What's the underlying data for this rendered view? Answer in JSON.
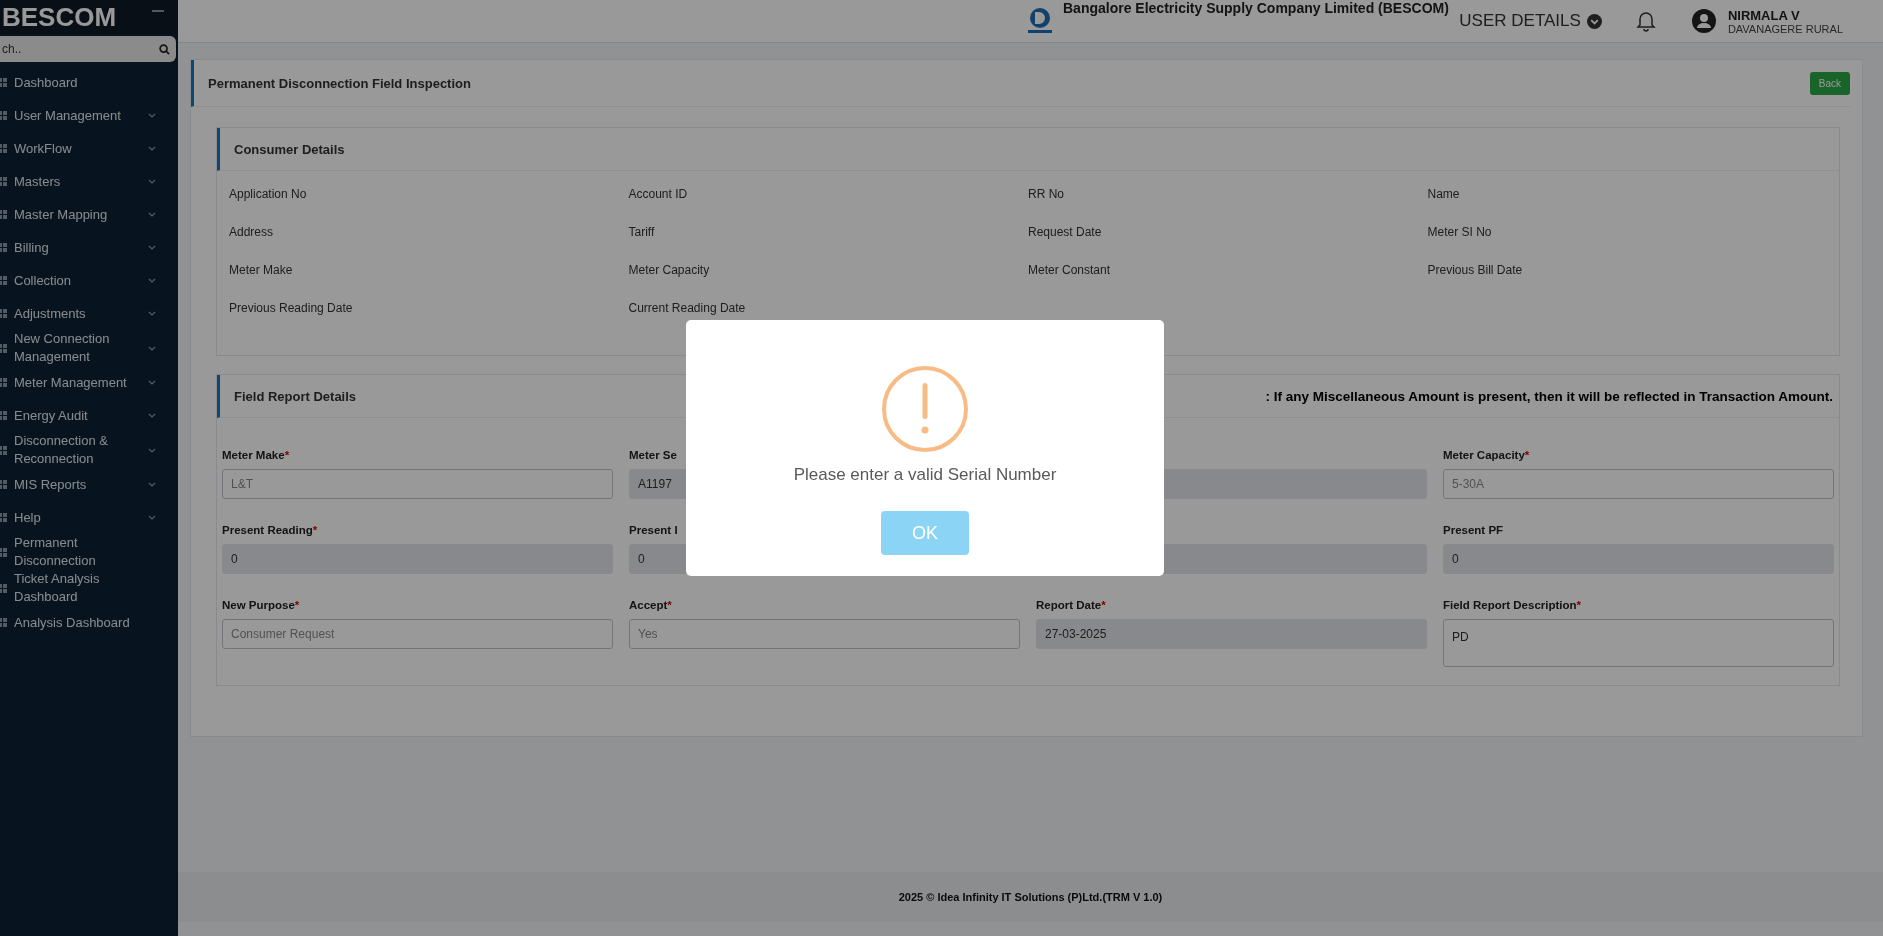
{
  "sidebar": {
    "brand": "BESCOM",
    "search": {
      "placeholder": "ch.."
    },
    "items": [
      {
        "label": "Dashboard",
        "has_submenu": false
      },
      {
        "label": "User Management",
        "has_submenu": true
      },
      {
        "label": "WorkFlow",
        "has_submenu": true
      },
      {
        "label": "Masters",
        "has_submenu": true
      },
      {
        "label": "Master Mapping",
        "has_submenu": true
      },
      {
        "label": "Billing",
        "has_submenu": true
      },
      {
        "label": "Collection",
        "has_submenu": true
      },
      {
        "label": "Adjustments",
        "has_submenu": true
      },
      {
        "label": "New Connection Management",
        "has_submenu": true
      },
      {
        "label": "Meter Management",
        "has_submenu": true
      },
      {
        "label": "Energy Audit",
        "has_submenu": true
      },
      {
        "label": "Disconnection & Reconnection",
        "has_submenu": true
      },
      {
        "label": "MIS Reports",
        "has_submenu": true
      },
      {
        "label": "Help",
        "has_submenu": true
      },
      {
        "label": "Permanent Disconnection",
        "has_submenu": false
      },
      {
        "label": "Ticket Analysis Dashboard",
        "has_submenu": false
      },
      {
        "label": "Analysis Dashboard",
        "has_submenu": false
      }
    ]
  },
  "header": {
    "company": "Bangalore Electricity Supply Company Limited (BESCOM)",
    "user_details": "USER DETAILS",
    "user_name": "NIRMALA V",
    "user_region": "DAVANAGERE RURAL"
  },
  "page": {
    "title": "Permanent Disconnection Field Inspection",
    "back_button": "Back"
  },
  "consumer_details": {
    "title": "Consumer Details",
    "fields": [
      "Application No",
      "Account ID",
      "RR No",
      "Name",
      "Address",
      "Tariff",
      "Request Date",
      "Meter SI No",
      "Meter Make",
      "Meter Capacity",
      "Meter Constant",
      "Previous Bill Date",
      "Previous Reading Date",
      "Current Reading Date"
    ]
  },
  "field_report": {
    "title": "Field Report Details",
    "note": ": If any Miscellaneous Amount is present, then it will be reflected in Transaction Amount.",
    "fields": [
      {
        "label": "Meter Make",
        "required_mark": "*",
        "kind": "select",
        "value": "L&T"
      },
      {
        "label": "Meter Se",
        "kind": "input",
        "value": "A1197"
      },
      {
        "kind": "input"
      },
      {
        "label": "Meter Capacity",
        "required_mark": "*",
        "kind": "select",
        "value": "5-30A"
      },
      {
        "label": "Present Reading",
        "required_mark": "*",
        "kind": "input",
        "value": "0"
      },
      {
        "label": "Present I",
        "kind": "input",
        "value": "0"
      },
      {
        "kind": "input"
      },
      {
        "label": "Present PF",
        "kind": "input",
        "value": "0"
      },
      {
        "label": "New Purpose",
        "required_mark": "*",
        "kind": "select",
        "value": "Consumer Request"
      },
      {
        "label": "Accept",
        "required_mark": "*",
        "kind": "select",
        "value": "Yes"
      },
      {
        "label": "Report Date",
        "required_mark": "*",
        "kind": "input",
        "value": "27-03-2025"
      },
      {
        "label": "Field Report Description",
        "required_mark": "*",
        "kind": "textarea",
        "value": "PD"
      }
    ]
  },
  "footer": "2025 © Idea Infinity IT Solutions (P)Ltd.(TRM V 1.0)",
  "dialog": {
    "message": "Please enter a valid Serial Number",
    "ok_button": "OK"
  }
}
